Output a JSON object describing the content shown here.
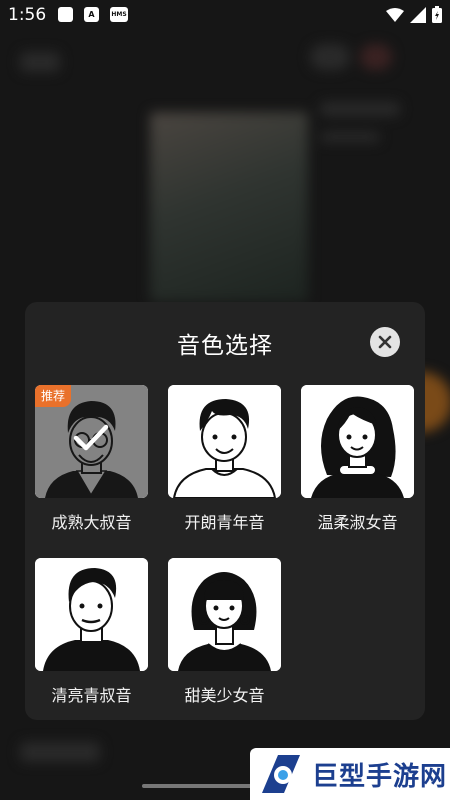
{
  "status_bar": {
    "time": "1:56",
    "icons": [
      "square-icon",
      "a-icon",
      "hms-icon"
    ],
    "hms_label": "HMS",
    "a_label": "A"
  },
  "dialog": {
    "title": "音色选择",
    "voices": [
      {
        "label": "成熟大叔音",
        "selected": true,
        "badge": "推荐"
      },
      {
        "label": "开朗青年音",
        "selected": false
      },
      {
        "label": "温柔淑女音",
        "selected": false
      },
      {
        "label": "清亮青叔音",
        "selected": false
      },
      {
        "label": "甜美少女音",
        "selected": false
      }
    ]
  },
  "watermark": {
    "text": "巨型手游网"
  },
  "colors": {
    "badge": "#e9712b",
    "dialog_bg": "#232323",
    "page_bg": "#161616"
  }
}
